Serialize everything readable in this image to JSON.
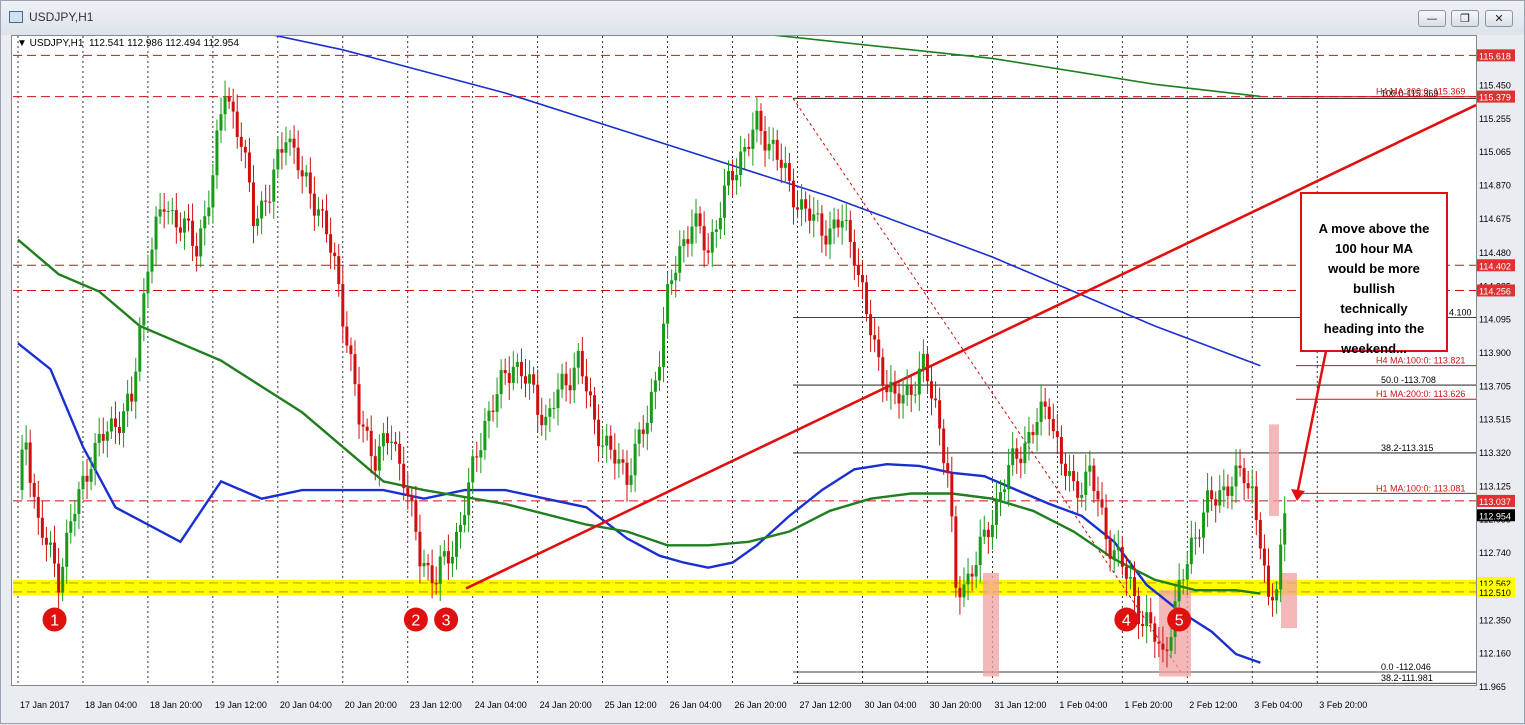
{
  "window": {
    "title": "USDJPY,H1",
    "buttons": {
      "minimize": "—",
      "maximize": "❐",
      "close": "✕"
    }
  },
  "header": {
    "symbol_line": "▼ USDJPY,H1  112.541 112.986 112.494 112.954"
  },
  "chart_data": {
    "type": "candlestick",
    "symbol": "USDJPY",
    "timeframe": "H1",
    "ohlc_last": {
      "open": 112.541,
      "high": 112.986,
      "low": 112.494,
      "close": 112.954
    },
    "ylim": [
      11.965,
      115.73
    ],
    "y_ticks": [
      115.45,
      115.255,
      115.065,
      114.87,
      114.675,
      114.48,
      114.285,
      114.095,
      113.9,
      113.705,
      113.515,
      113.32,
      113.125,
      112.935,
      112.74,
      112.545,
      112.35,
      112.16,
      111.965
    ],
    "y_tick_labels": [
      "115.450",
      "115.255",
      "115.065",
      "114.870",
      "114.675",
      "114.480",
      "114.285",
      "114.095",
      "113.900",
      "113.705",
      "113.515",
      "113.320",
      "113.125",
      "112.935",
      "112.740",
      "112.545",
      "112.350",
      "112.160",
      "11.965"
    ],
    "x_ticks": [
      {
        "bar": 0,
        "label": "17 Jan 2017"
      },
      {
        "bar": 16,
        "label": "18 Jan 04:00"
      },
      {
        "bar": 32,
        "label": "18 Jan 20:00"
      },
      {
        "bar": 48,
        "label": "19 Jan 12:00"
      },
      {
        "bar": 64,
        "label": "20 Jan 04:00"
      },
      {
        "bar": 80,
        "label": "20 Jan 20:00"
      },
      {
        "bar": 96,
        "label": "23 Jan 12:00"
      },
      {
        "bar": 112,
        "label": "24 Jan 04:00"
      },
      {
        "bar": 128,
        "label": "24 Jan 20:00"
      },
      {
        "bar": 144,
        "label": "25 Jan 12:00"
      },
      {
        "bar": 160,
        "label": "26 Jan 04:00"
      },
      {
        "bar": 176,
        "label": "26 Jan 20:00"
      },
      {
        "bar": 192,
        "label": "27 Jan 12:00"
      },
      {
        "bar": 208,
        "label": "30 Jan 04:00"
      },
      {
        "bar": 224,
        "label": "30 Jan 20:00"
      },
      {
        "bar": 240,
        "label": "31 Jan 12:00"
      },
      {
        "bar": 256,
        "label": "1 Feb 04:00"
      },
      {
        "bar": 272,
        "label": "1 Feb 20:00"
      },
      {
        "bar": 288,
        "label": "2 Feb 12:00"
      },
      {
        "bar": 304,
        "label": "3 Feb 04:00"
      },
      {
        "bar": 320,
        "label": "3 Feb 20:00"
      }
    ],
    "price_path": [
      [
        0,
        113.1
      ],
      [
        2,
        113.4
      ],
      [
        5,
        112.9
      ],
      [
        10,
        112.6
      ],
      [
        13,
        112.9
      ],
      [
        18,
        113.3
      ],
      [
        24,
        113.5
      ],
      [
        28,
        113.6
      ],
      [
        32,
        114.45
      ],
      [
        36,
        114.75
      ],
      [
        40,
        114.65
      ],
      [
        44,
        114.5
      ],
      [
        48,
        114.9
      ],
      [
        51,
        115.45
      ],
      [
        55,
        115.1
      ],
      [
        58,
        114.7
      ],
      [
        62,
        114.8
      ],
      [
        66,
        115.2
      ],
      [
        70,
        114.9
      ],
      [
        74,
        114.75
      ],
      [
        78,
        114.4
      ],
      [
        81,
        114.0
      ],
      [
        84,
        113.5
      ],
      [
        88,
        113.3
      ],
      [
        92,
        113.4
      ],
      [
        95,
        113.2
      ],
      [
        99,
        112.7
      ],
      [
        103,
        112.6
      ],
      [
        107,
        112.75
      ],
      [
        111,
        113.1
      ],
      [
        115,
        113.5
      ],
      [
        119,
        113.7
      ],
      [
        122,
        113.85
      ],
      [
        126,
        113.7
      ],
      [
        130,
        113.5
      ],
      [
        134,
        113.7
      ],
      [
        138,
        113.85
      ],
      [
        142,
        113.5
      ],
      [
        146,
        113.3
      ],
      [
        150,
        113.2
      ],
      [
        155,
        113.5
      ],
      [
        158,
        113.9
      ],
      [
        160,
        114.2
      ],
      [
        163,
        114.5
      ],
      [
        166,
        114.65
      ],
      [
        170,
        114.5
      ],
      [
        174,
        114.8
      ],
      [
        178,
        115.05
      ],
      [
        182,
        115.2
      ],
      [
        186,
        115.1
      ],
      [
        190,
        114.85
      ],
      [
        193,
        114.75
      ],
      [
        196,
        114.65
      ],
      [
        200,
        114.6
      ],
      [
        203,
        114.65
      ],
      [
        206,
        114.5
      ],
      [
        209,
        114.1
      ],
      [
        212,
        113.85
      ],
      [
        216,
        113.6
      ],
      [
        220,
        113.7
      ],
      [
        223,
        113.8
      ],
      [
        226,
        113.6
      ],
      [
        229,
        113.2
      ],
      [
        231,
        112.5
      ],
      [
        234,
        112.6
      ],
      [
        238,
        112.8
      ],
      [
        242,
        113.1
      ],
      [
        246,
        113.3
      ],
      [
        250,
        113.45
      ],
      [
        254,
        113.6
      ],
      [
        257,
        113.25
      ],
      [
        260,
        113.1
      ],
      [
        264,
        113.2
      ],
      [
        268,
        112.85
      ],
      [
        271,
        112.7
      ],
      [
        274,
        112.55
      ],
      [
        277,
        112.35
      ],
      [
        280,
        112.25
      ],
      [
        282,
        112.15
      ],
      [
        285,
        112.4
      ],
      [
        289,
        112.8
      ],
      [
        293,
        113.0
      ],
      [
        296,
        113.1
      ],
      [
        300,
        113.15
      ],
      [
        302,
        113.2
      ],
      [
        304,
        113.1
      ],
      [
        306,
        112.8
      ],
      [
        308,
        112.4
      ],
      [
        310,
        112.6
      ],
      [
        312,
        112.95
      ]
    ],
    "ma_series": [
      {
        "name": "H1 MA:100:0",
        "value": 113.081,
        "color": "#1a2fd0",
        "points": [
          [
            0,
            113.95
          ],
          [
            8,
            113.8
          ],
          [
            16,
            113.35
          ],
          [
            24,
            113.0
          ],
          [
            32,
            112.9
          ],
          [
            40,
            112.8
          ],
          [
            50,
            113.15
          ],
          [
            60,
            113.05
          ],
          [
            70,
            113.1
          ],
          [
            80,
            113.1
          ],
          [
            90,
            113.1
          ],
          [
            100,
            113.05
          ],
          [
            110,
            113.1
          ],
          [
            120,
            113.1
          ],
          [
            130,
            113.05
          ],
          [
            140,
            113.0
          ],
          [
            150,
            112.82
          ],
          [
            158,
            112.72
          ],
          [
            164,
            112.68
          ],
          [
            170,
            112.65
          ],
          [
            176,
            112.68
          ],
          [
            182,
            112.78
          ],
          [
            190,
            112.95
          ],
          [
            198,
            113.1
          ],
          [
            206,
            113.22
          ],
          [
            214,
            113.25
          ],
          [
            222,
            113.24
          ],
          [
            230,
            113.2
          ],
          [
            238,
            113.18
          ],
          [
            246,
            113.1
          ],
          [
            254,
            113.02
          ],
          [
            262,
            112.95
          ],
          [
            270,
            112.8
          ],
          [
            278,
            112.55
          ],
          [
            286,
            112.4
          ],
          [
            294,
            112.28
          ],
          [
            300,
            112.15
          ],
          [
            306,
            112.1
          ]
        ]
      },
      {
        "name": "H1 MA:200:0",
        "value": 113.626,
        "color": "#1f7f1f",
        "points": [
          [
            0,
            114.55
          ],
          [
            10,
            114.35
          ],
          [
            20,
            114.25
          ],
          [
            30,
            114.05
          ],
          [
            40,
            113.95
          ],
          [
            50,
            113.85
          ],
          [
            60,
            113.7
          ],
          [
            70,
            113.55
          ],
          [
            80,
            113.35
          ],
          [
            90,
            113.15
          ],
          [
            100,
            113.1
          ],
          [
            110,
            113.06
          ],
          [
            120,
            113.02
          ],
          [
            130,
            112.96
          ],
          [
            140,
            112.9
          ],
          [
            150,
            112.86
          ],
          [
            160,
            112.78
          ],
          [
            170,
            112.78
          ],
          [
            180,
            112.8
          ],
          [
            190,
            112.86
          ],
          [
            200,
            112.98
          ],
          [
            210,
            113.05
          ],
          [
            220,
            113.08
          ],
          [
            230,
            113.08
          ],
          [
            240,
            113.05
          ],
          [
            250,
            112.98
          ],
          [
            260,
            112.86
          ],
          [
            270,
            112.7
          ],
          [
            280,
            112.58
          ],
          [
            290,
            112.52
          ],
          [
            300,
            112.52
          ],
          [
            306,
            112.5
          ]
        ]
      },
      {
        "name": "H4 MA:100:0",
        "value": 113.821,
        "color": "#1a2fd0",
        "points": [
          [
            0,
            116.0
          ],
          [
            40,
            115.85
          ],
          [
            80,
            115.65
          ],
          [
            120,
            115.4
          ],
          [
            160,
            115.1
          ],
          [
            200,
            114.8
          ],
          [
            240,
            114.45
          ],
          [
            280,
            114.05
          ],
          [
            306,
            113.82
          ]
        ]
      },
      {
        "name": "H4 MA:200:0",
        "value": 115.379,
        "color": "#1f7f1f",
        "points": [
          [
            0,
            116.1
          ],
          [
            60,
            115.98
          ],
          [
            120,
            115.85
          ],
          [
            180,
            115.75
          ],
          [
            240,
            115.6
          ],
          [
            280,
            115.45
          ],
          [
            306,
            115.38
          ]
        ]
      }
    ],
    "horizontal_lines": [
      {
        "value": 115.618,
        "label": "115.618",
        "style": "red-dash"
      },
      {
        "value": 115.379,
        "label": "115.379",
        "style": "red-dash"
      },
      {
        "value": 114.402,
        "label": "114.402",
        "style": "red-dash"
      },
      {
        "value": 114.256,
        "label": "114.256",
        "style": "red-dash"
      },
      {
        "value": 113.037,
        "label": "113.037",
        "style": "red-dash"
      },
      {
        "value": 112.562,
        "label": "112.562",
        "style": "yellow"
      },
      {
        "value": 112.51,
        "label": "112.510",
        "style": "yellow"
      }
    ],
    "fibonacci": [
      {
        "value": 115.369,
        "label": "100.0-115.369"
      },
      {
        "value": 114.1,
        "label": "4.100"
      },
      {
        "value": 113.708,
        "label": "50.0 -113.708"
      },
      {
        "value": 113.315,
        "label": "38.2-113.315"
      },
      {
        "value": 112.046,
        "label": "0.0 -112.046"
      },
      {
        "value": 111.981,
        "label": "38.2-111.981"
      }
    ],
    "ma_labels": [
      {
        "value": 115.379,
        "label": "H4 MA:200:0: 115.369"
      },
      {
        "value": 113.821,
        "label": "H4 MA:100:0: 113.821"
      },
      {
        "value": 113.626,
        "label": "H1 MA:200:0: 113.626"
      },
      {
        "value": 113.081,
        "label": "H1 MA:100:0: 113.081"
      }
    ],
    "current_price_label": "112.954",
    "markers": [
      {
        "label": "1",
        "bar": 9
      },
      {
        "label": "2",
        "bar": 98
      },
      {
        "label": "3",
        "bar": 102
      },
      {
        "label": "4",
        "bar": 273
      },
      {
        "label": "5",
        "bar": 286
      }
    ],
    "annotation": "A move above the 100 hour MA would be more bullish technically heading into the weekend..."
  }
}
